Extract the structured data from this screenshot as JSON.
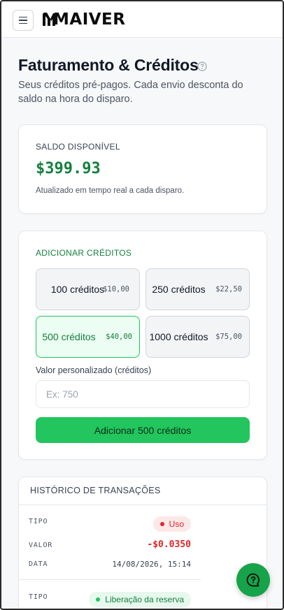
{
  "header": {
    "brand": "MAIVER",
    "icons": {
      "menu": "hamburger-menu-icon",
      "logo": "maiver-logo"
    }
  },
  "page": {
    "title": "Faturamento & Créditos",
    "subtitle": "Seus créditos pré-pagos. Cada envio desconta do saldo na hora do disparo.",
    "help_icon": "help-circle-icon"
  },
  "balance": {
    "label": "SALDO DISPONÍVEL",
    "value": "$399.93",
    "note": "Atualizado em tempo real a cada disparo."
  },
  "add_credits": {
    "label": "ADICIONAR CRÉDITOS",
    "packages": [
      {
        "name": "100 créditos",
        "price": "$10,00",
        "selected": false
      },
      {
        "name": "250 créditos",
        "price": "$22,50",
        "selected": false
      },
      {
        "name": "500 créditos",
        "price": "$40,00",
        "selected": true
      },
      {
        "name": "1000 créditos",
        "price": "$75,00",
        "selected": false
      }
    ],
    "custom_label": "Valor personalizado (créditos)",
    "custom_placeholder": "Ex: 750",
    "custom_value": "",
    "button_label": "Adicionar 500 créditos"
  },
  "history": {
    "title": "HISTÓRICO DE TRANSAÇÕES",
    "key_type": "TIPO",
    "key_value": "VALOR",
    "key_date": "DATA",
    "transactions": [
      {
        "type": "Uso",
        "status_color": "#dc2626",
        "value": "-$0.0350",
        "date": "14/08/2026, 15:14"
      },
      {
        "type": "Liberação da reserva",
        "status_color": "#22c55e",
        "value": "",
        "date": ""
      }
    ]
  },
  "fab": {
    "icon": "chat-help-icon"
  },
  "colors": {
    "accent": "#22c55e",
    "accent_dark": "#15803d",
    "negative": "#dc2626"
  }
}
